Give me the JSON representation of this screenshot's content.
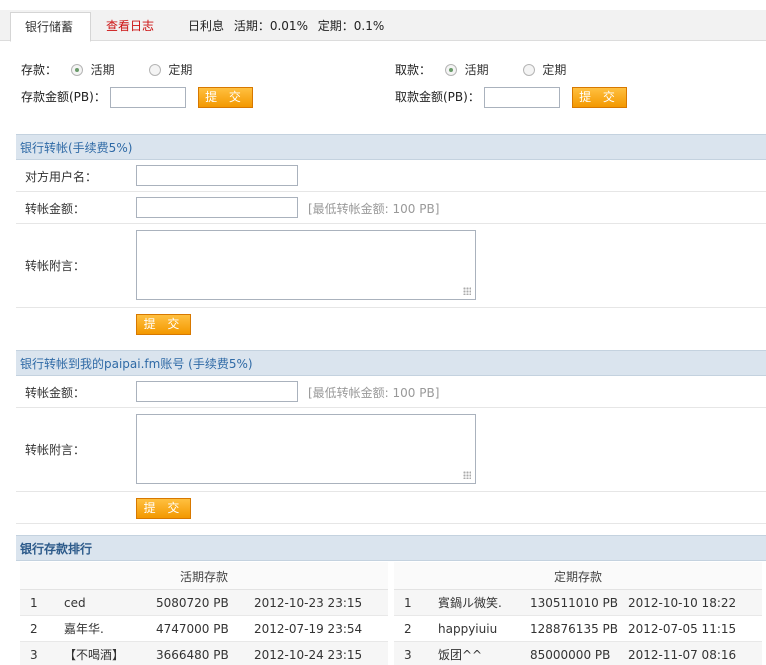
{
  "tabs": [
    {
      "label": "银行储蓄"
    },
    {
      "label": "查看日志"
    }
  ],
  "rates": {
    "label": "日利息",
    "current": "活期：0.01%",
    "fixed": "定期：0.1%"
  },
  "deposit": {
    "label": "存款：",
    "opt_current": "活期",
    "opt_fixed": "定期",
    "amount_label": "存款金额(PB)：",
    "submit": "提 交"
  },
  "withdraw": {
    "label": "取款：",
    "opt_current": "活期",
    "opt_fixed": "定期",
    "amount_label": "取款金额(PB)：",
    "submit": "提 交"
  },
  "transfer": {
    "title": "银行转帐(手续费5%)",
    "user_label": "对方用户名：",
    "amount_label": "转帐金额：",
    "amount_hint": "[最低转帐金额: 100 PB]",
    "note_label": "转帐附言：",
    "submit": "提 交"
  },
  "transfer_fm": {
    "title": "银行转帐到我的paipai.fm账号 (手续费5%)",
    "amount_label": "转帐金额：",
    "amount_hint": "[最低转帐金额: 100 PB]",
    "note_label": "转帐附言：",
    "submit": "提 交"
  },
  "ranking": {
    "title": "银行存款排行",
    "current_header": "活期存款",
    "fixed_header": "定期存款",
    "current_rows": [
      {
        "rank": "1",
        "user": "ced",
        "amount": "5080720 PB",
        "date": "2012-10-23 23:15"
      },
      {
        "rank": "2",
        "user": "嘉年华.",
        "amount": "4747000 PB",
        "date": "2012-07-19 23:54"
      },
      {
        "rank": "3",
        "user": "【不喝酒】",
        "amount": "3666480 PB",
        "date": "2012-10-24 23:15"
      }
    ],
    "fixed_rows": [
      {
        "rank": "1",
        "user": "賓鍋ル微笑.",
        "amount": "130511010 PB",
        "date": "2012-10-10 18:22"
      },
      {
        "rank": "2",
        "user": "happyiuiu",
        "amount": "128876135 PB",
        "date": "2012-07-05 11:15"
      },
      {
        "rank": "3",
        "user": "饭团^^",
        "amount": "85000000 PB",
        "date": "2012-11-07 08:16"
      }
    ]
  }
}
